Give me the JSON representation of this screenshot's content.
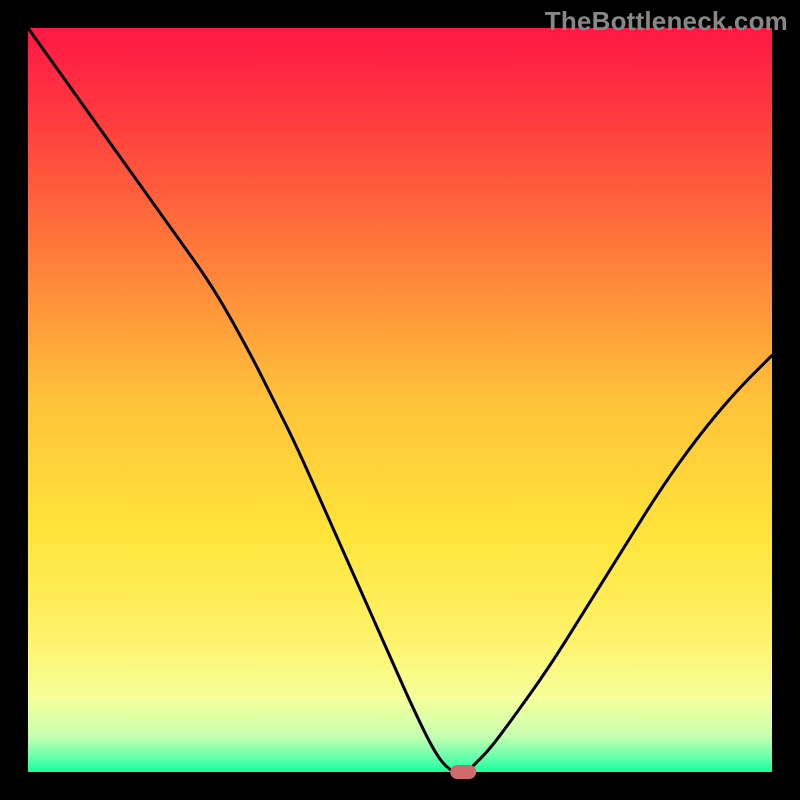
{
  "watermark": "TheBottleneck.com",
  "chart_data": {
    "type": "line",
    "title": "",
    "xlabel": "",
    "ylabel": "",
    "xlim": [
      0,
      100
    ],
    "ylim": [
      0,
      100
    ],
    "note": "Values are relative percentages read from the bottleneck curve plot. Axes have no visible tick labels. The minimum (~0%) occurs near x≈58.",
    "x": [
      0,
      5,
      10,
      15,
      20,
      25,
      30,
      33,
      36,
      40,
      44,
      48,
      52,
      55,
      57,
      58,
      59,
      60,
      62,
      65,
      70,
      75,
      80,
      85,
      90,
      95,
      100
    ],
    "values": [
      100,
      93,
      86,
      79,
      72,
      65,
      56,
      50,
      44,
      35,
      26,
      17,
      8,
      2,
      0,
      0,
      0,
      1,
      3,
      7,
      14,
      22,
      30,
      38,
      45,
      51,
      56
    ],
    "marker": {
      "x": 58.5,
      "y": 0,
      "color": "#cf6a6f"
    },
    "background_gradient": {
      "stops": [
        {
          "offset": 0.0,
          "color": "#ff1744"
        },
        {
          "offset": 0.12,
          "color": "#ff3a3f"
        },
        {
          "offset": 0.3,
          "color": "#ff7a3a"
        },
        {
          "offset": 0.5,
          "color": "#ffc23a"
        },
        {
          "offset": 0.68,
          "color": "#ffe43a"
        },
        {
          "offset": 0.82,
          "color": "#fff26a"
        },
        {
          "offset": 0.9,
          "color": "#f6ff9a"
        },
        {
          "offset": 0.95,
          "color": "#c9ffb0"
        },
        {
          "offset": 0.975,
          "color": "#7affad"
        },
        {
          "offset": 1.0,
          "color": "#1aff9e"
        }
      ]
    },
    "frame_color": "#000000",
    "frame_width_pct": 0.035
  }
}
